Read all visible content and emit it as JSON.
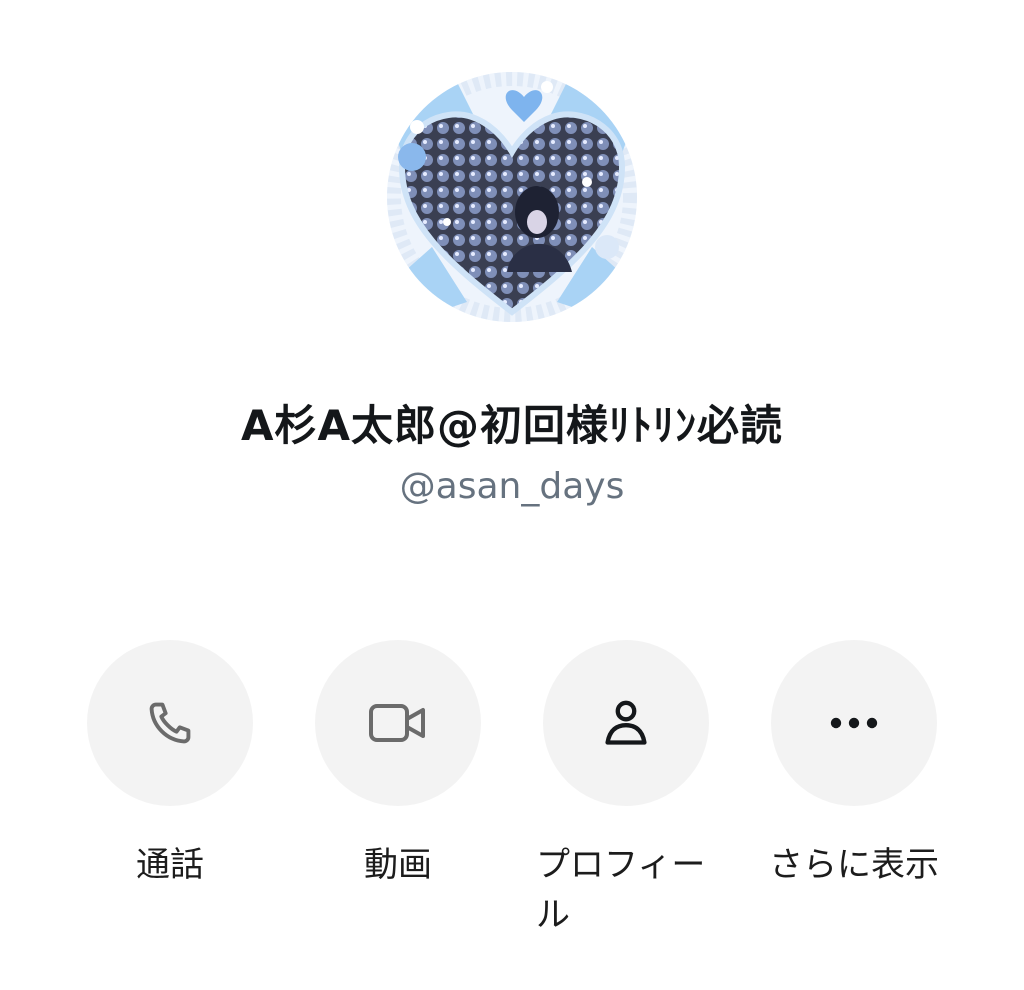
{
  "profile": {
    "display_name": "A杉A太郎@初回様ﾘﾄﾘﾝ必読",
    "handle": "@asan_days",
    "avatar": "heart-frame-avatar-image"
  },
  "actions": [
    {
      "label": "通話",
      "icon": "phone-icon"
    },
    {
      "label": "動画",
      "icon": "video-icon"
    },
    {
      "label": "プロフィール",
      "icon": "person-icon"
    },
    {
      "label": "さらに表示",
      "icon": "more-icon"
    }
  ],
  "colors": {
    "background": "#ffffff",
    "button_bg": "#f3f3f3",
    "handle_text": "#66727f",
    "icon_gray": "#6b6b6b",
    "icon_dark": "#14171a",
    "avatar_blue": "#a9d3f5"
  }
}
